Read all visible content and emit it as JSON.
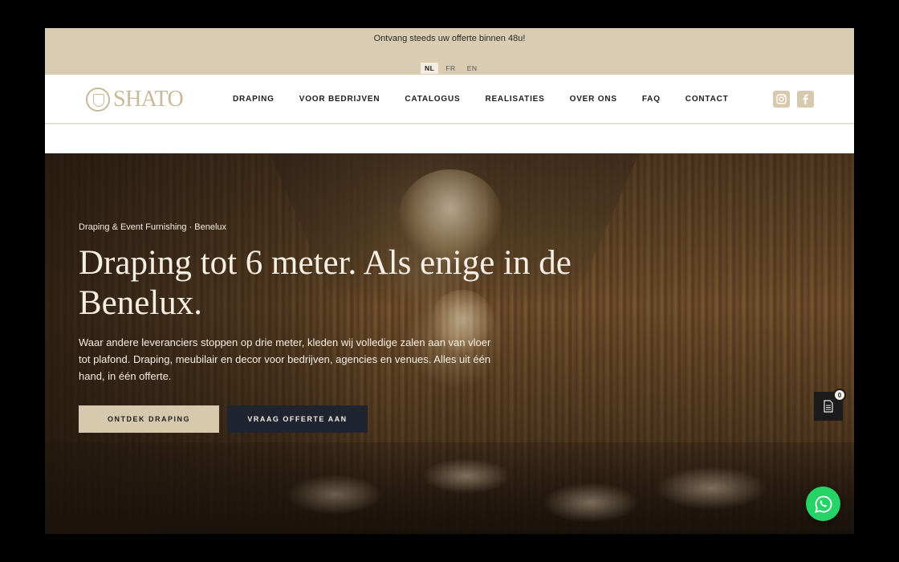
{
  "topbar": {
    "announcement": "Ontvang steeds uw offerte binnen 48u!",
    "languages": [
      {
        "code": "NL",
        "active": true
      },
      {
        "code": "FR",
        "active": false
      },
      {
        "code": "EN",
        "active": false
      }
    ]
  },
  "header": {
    "logo_text": "SHATO",
    "nav": [
      {
        "label": "DRAPING"
      },
      {
        "label": "VOOR BEDRIJVEN"
      },
      {
        "label": "CATALOGUS"
      },
      {
        "label": "REALISATIES"
      },
      {
        "label": "OVER ONS"
      },
      {
        "label": "FAQ"
      },
      {
        "label": "CONTACT"
      }
    ],
    "socials": [
      "instagram-icon",
      "facebook-icon"
    ]
  },
  "hero": {
    "eyebrow": "Draping & Event Furnishing · Benelux",
    "title": "Draping tot 6 meter. Als enige in de Benelux.",
    "text": "Waar andere leveranciers stoppen op drie meter, kleden wij volledige zalen aan van vloer tot plafond. Draping, meubilair en decor voor bedrijven, agencies en venues. Alles uit één hand, in één offerte.",
    "primary_button": "ONTDEK DRAPING",
    "secondary_button": "VRAAG OFFERTE AAN"
  },
  "quote_widget": {
    "count": "0",
    "icon": "document-icon"
  },
  "whatsapp": {
    "icon": "whatsapp-icon"
  },
  "colors": {
    "topbar": "#d9ccb3",
    "gold": "#c8b998",
    "primary_button": "#d6c8ad",
    "secondary_button": "#1f2430",
    "whatsapp": "#25d366"
  }
}
